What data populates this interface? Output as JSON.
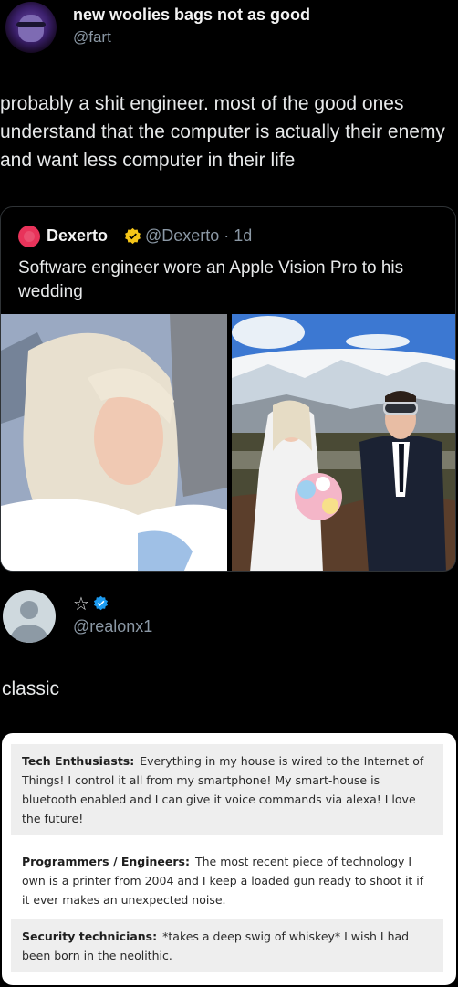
{
  "top_tweet": {
    "display_name": "new woolies bags not as good",
    "handle": "@fart",
    "text": "probably a shit engineer. most of the good ones understand that the computer is actually their enemy and want less computer in their life"
  },
  "quoted_tweet": {
    "author": "Dexerto",
    "handle_time": "@Dexerto · 1d",
    "text": "Software engineer wore an Apple Vision Pro to his wedding",
    "badge_color": "#f5c518"
  },
  "reply_tweet": {
    "name_symbol": "☆",
    "handle": "@realonx1",
    "text": "classic",
    "verified_color": "#1d9bf0"
  },
  "meme": {
    "blocks": [
      {
        "heading": "Tech Enthusiasts:",
        "body": "Everything in my house is wired to the Internet of Things! I control it all from my smartphone! My smart-house is bluetooth enabled and I can give it voice commands via alexa! I love the future!"
      },
      {
        "heading": "Programmers / Engineers:",
        "body": "The most recent piece of technology I own is a printer from 2004 and I keep a loaded gun ready to shoot it if it ever makes an unexpected noise."
      },
      {
        "heading": "Security technicians:",
        "body": "*takes a deep swig of whiskey* I wish I had been born in the neolithic."
      }
    ]
  }
}
